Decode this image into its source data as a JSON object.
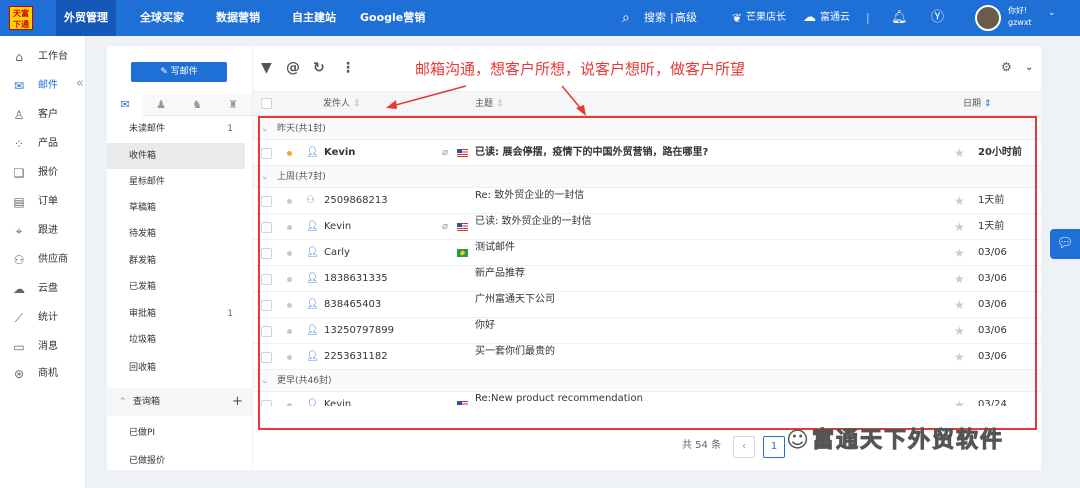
{
  "topbar": {
    "logo_text": "天富下通",
    "nav": [
      "外贸管理",
      "全球买家",
      "数据营销",
      "自主建站",
      "Google营销"
    ],
    "search_label": "搜索",
    "advanced_label": "高级",
    "shop_label": "芒果店长",
    "cloud_label": "富通云",
    "greeting": "你好!",
    "username": "gzwxt"
  },
  "sidebar": {
    "items": [
      {
        "label": "工作台",
        "icon": "home-icon"
      },
      {
        "label": "邮件",
        "icon": "mail-icon"
      },
      {
        "label": "客户",
        "icon": "user-icon"
      },
      {
        "label": "产品",
        "icon": "grid-icon"
      },
      {
        "label": "报价",
        "icon": "quote-icon"
      },
      {
        "label": "订单",
        "icon": "order-icon"
      },
      {
        "label": "跟进",
        "icon": "location-icon"
      },
      {
        "label": "供应商",
        "icon": "supplier-icon"
      },
      {
        "label": "云盘",
        "icon": "cloud-icon"
      },
      {
        "label": "统计",
        "icon": "chart-icon"
      },
      {
        "label": "消息",
        "icon": "message-icon"
      },
      {
        "label": "商机",
        "icon": "opportunity-icon"
      }
    ]
  },
  "folders": {
    "compose_label": "写邮件",
    "items": [
      {
        "label": "未读邮件",
        "count": "1"
      },
      {
        "label": "收件箱",
        "count": ""
      },
      {
        "label": "星标邮件",
        "count": ""
      },
      {
        "label": "草稿箱",
        "count": ""
      },
      {
        "label": "待发箱",
        "count": ""
      },
      {
        "label": "群发箱",
        "count": ""
      },
      {
        "label": "已发箱",
        "count": ""
      },
      {
        "label": "审批箱",
        "count": "1"
      },
      {
        "label": "垃圾箱",
        "count": ""
      },
      {
        "label": "回收箱",
        "count": ""
      }
    ],
    "query_label": "查询箱",
    "query_items": [
      "已做PI",
      "已做报价"
    ]
  },
  "mail": {
    "annotation": "邮箱沟通，想客户所想，说客户想听，做客户所望",
    "columns": {
      "sender": "发件人",
      "subject": "主题",
      "date": "日期"
    },
    "groups": [
      {
        "label": "昨天(共1封)",
        "rows": [
          {
            "sender": "Kevin",
            "subject": "已读: 展会停摆，疫情下的中国外贸营销，路在哪里?",
            "date": "20小时前",
            "unread": true,
            "clip": true,
            "flag": "us"
          }
        ]
      },
      {
        "label": "上周(共7封)",
        "rows": [
          {
            "sender": "2509868213",
            "subject": "Re: 致外贸企业的一封信",
            "date": "1天前",
            "unread": false,
            "clip": false,
            "flag": "",
            "icon": "group"
          },
          {
            "sender": "Kevin",
            "subject": "已读: 致外贸企业的一封信",
            "date": "1天前",
            "unread": false,
            "clip": true,
            "flag": "us"
          },
          {
            "sender": "Carly",
            "subject": "测试邮件",
            "date": "03/06",
            "unread": false,
            "clip": false,
            "flag": "br"
          },
          {
            "sender": "1838631335",
            "subject": "新产品推荐",
            "date": "03/06",
            "unread": false,
            "clip": false,
            "flag": ""
          },
          {
            "sender": "838465403",
            "subject": "广州富通天下公司",
            "date": "03/06",
            "unread": false,
            "clip": false,
            "flag": ""
          },
          {
            "sender": "13250797899",
            "subject": "你好",
            "date": "03/06",
            "unread": false,
            "clip": false,
            "flag": ""
          },
          {
            "sender": "2253631182",
            "subject": "买一套你们最贵的",
            "date": "03/06",
            "unread": false,
            "clip": false,
            "flag": ""
          }
        ]
      },
      {
        "label": "更早(共46封)",
        "rows": [
          {
            "sender": "Kevin",
            "subject": "Re:New product recommendation",
            "date": "03/24",
            "unread": false,
            "clip": false,
            "flag": "us"
          }
        ]
      }
    ],
    "total_label": "共 54 条",
    "current_page": "1"
  },
  "watermark": "富通天下外贸软件",
  "colors": {
    "primary": "#1e6fd6",
    "annotation": "#e53935",
    "unread_dot": "#f5a623"
  }
}
